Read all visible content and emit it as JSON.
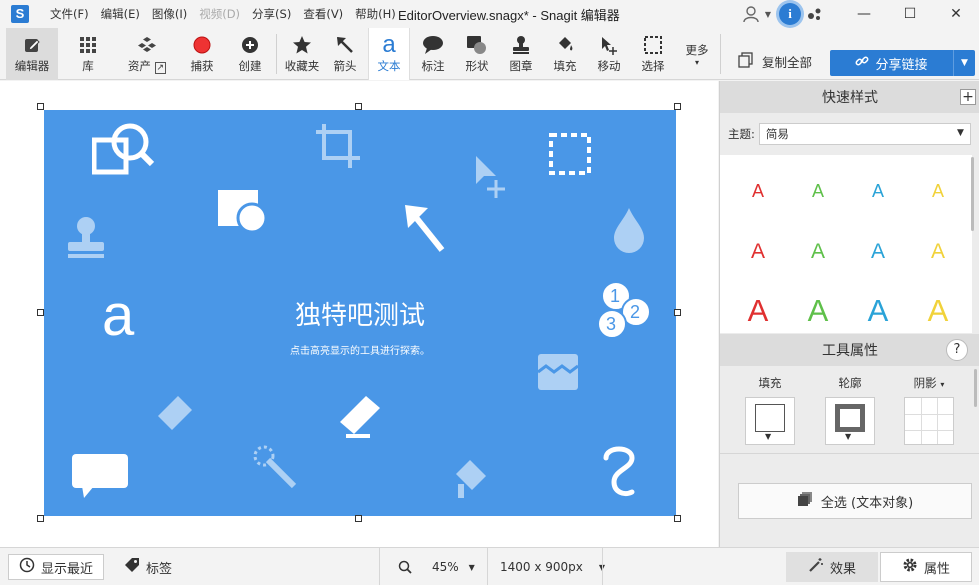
{
  "titlebar": {
    "app_icon": "S",
    "menu": [
      "文件(F)",
      "编辑(E)",
      "图像(I)",
      "视频(D)",
      "分享(S)",
      "查看(V)",
      "帮助(H)"
    ],
    "document_title": "EditorOverview.snagx* - Snagit 编辑器",
    "info_icon": "i"
  },
  "toolbar": {
    "editor": "编辑器",
    "library": "库",
    "assets": "资产",
    "capture": "捕获",
    "create": "创建",
    "favorites": "收藏夹",
    "arrow": "箭头",
    "text": "文本",
    "callout": "标注",
    "shape": "形状",
    "stamp": "图章",
    "fill": "填充",
    "move": "移动",
    "select": "选择",
    "more": "更多",
    "copy_all": "复制全部",
    "share_link": "分享链接"
  },
  "canvas": {
    "title": "独特吧测试",
    "subtitle": "点击高亮显示的工具进行探索。",
    "letter_a": "a",
    "num1": "1",
    "num2": "2",
    "num3": "3"
  },
  "right_panel": {
    "quick_styles_title": "快速样式",
    "theme_label": "主题:",
    "theme_value": "简易",
    "style_letter": "A",
    "style_colors": [
      "#e03030",
      "#5fc04a",
      "#2aa3d8",
      "#f1d23a"
    ],
    "tool_props_title": "工具属性",
    "help": "?",
    "fill_label": "填充",
    "outline_label": "轮廓",
    "shadow_label": "阴影",
    "select_all": "全选 (文本对象)"
  },
  "statusbar": {
    "show_recent": "显示最近",
    "tags": "标签",
    "zoom": "45%",
    "dimensions": "1400 x 900px",
    "effects": "效果",
    "properties": "属性"
  }
}
